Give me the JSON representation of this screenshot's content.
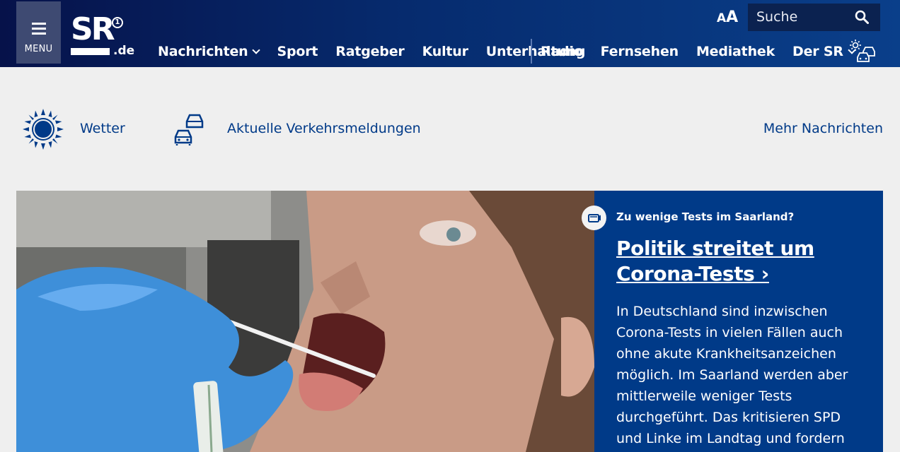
{
  "header": {
    "menu_label": "MENU",
    "logo_text": "SR",
    "logo_tld": ".de",
    "logo_ard": "1",
    "font_small": "A",
    "font_large": "A",
    "search_placeholder": "Suche",
    "nav": [
      {
        "label": "Nachrichten",
        "dropdown": true
      },
      {
        "label": "Sport"
      },
      {
        "label": "Ratgeber"
      },
      {
        "label": "Kultur"
      },
      {
        "label": "Unterhaltung"
      }
    ],
    "nav2": [
      {
        "label": "Radio"
      },
      {
        "label": "Fernsehen"
      },
      {
        "label": "Mediathek"
      },
      {
        "label": "Der SR",
        "dropdown": true
      }
    ],
    "colors": {
      "brand": "#003a88",
      "header_dark": "#06124a"
    }
  },
  "quick_links": {
    "wetter": "Wetter",
    "traffic": "Aktuelle Verkehrsmeldungen",
    "mehr": "Mehr Nachrichten"
  },
  "teaser": {
    "kicker": "Zu wenige Tests im Saarland?",
    "title": "Politik streitet um Corona-Tests ›",
    "text": "In Deutschland sind inzwischen Corona-Tests in vielen Fällen auch ohne akute Krankheitsanzeichen möglich. Im Saarland werden aber mittlerweile weniger Tests durchgeführt. Das kritisieren SPD und Linke im Landtag und fordern ein umfassendes",
    "badge_icon": "video-camera-icon"
  }
}
